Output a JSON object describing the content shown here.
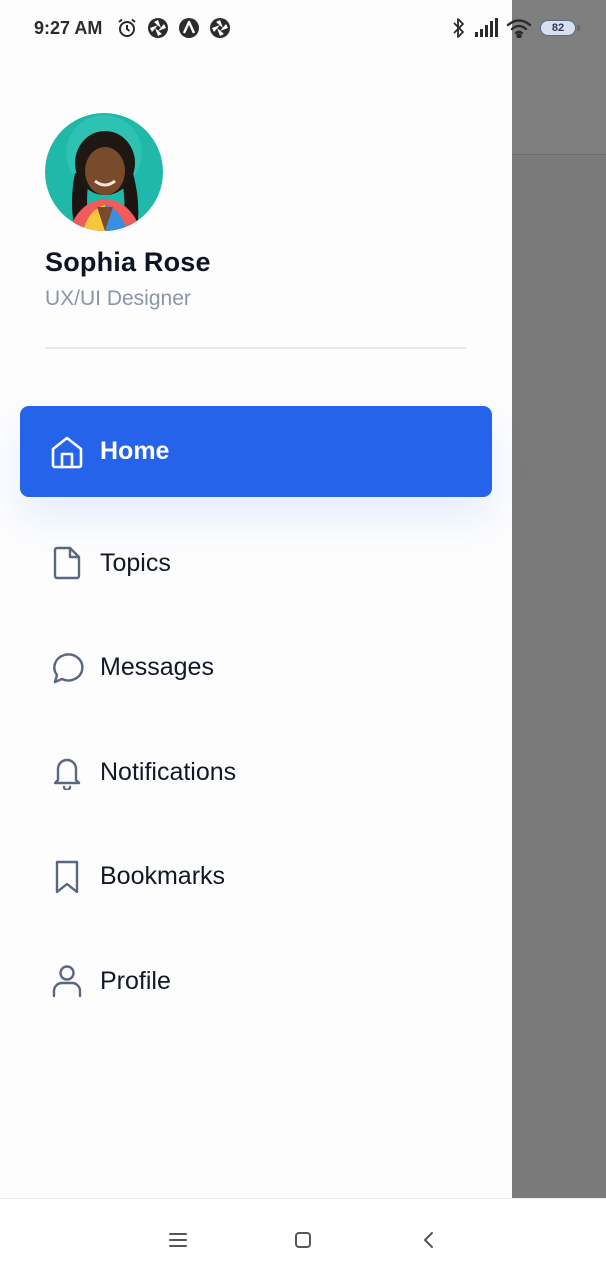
{
  "status_bar": {
    "time": "9:27 AM",
    "left_icons": [
      "alarm-icon",
      "aperture-icon",
      "app-a-icon",
      "aperture-icon"
    ],
    "right_icons": [
      "bluetooth-icon",
      "signal-icon",
      "wifi-icon"
    ],
    "battery": "82"
  },
  "profile": {
    "name": "Sophia Rose",
    "role": "UX/UI Designer"
  },
  "menu": {
    "items": [
      {
        "label": "Home",
        "icon": "home-icon",
        "active": true
      },
      {
        "label": "Topics",
        "icon": "document-icon",
        "active": false
      },
      {
        "label": "Messages",
        "icon": "chat-icon",
        "active": false
      },
      {
        "label": "Notifications",
        "icon": "bell-icon",
        "active": false
      },
      {
        "label": "Bookmarks",
        "icon": "bookmark-icon",
        "active": false
      },
      {
        "label": "Profile",
        "icon": "user-icon",
        "active": false
      }
    ]
  },
  "colors": {
    "accent": "#2563eb",
    "icon_stroke": "#5b6780",
    "overlay": "#7a7a7a"
  },
  "system_nav": [
    "menu-icon",
    "home-square-icon",
    "back-icon"
  ]
}
